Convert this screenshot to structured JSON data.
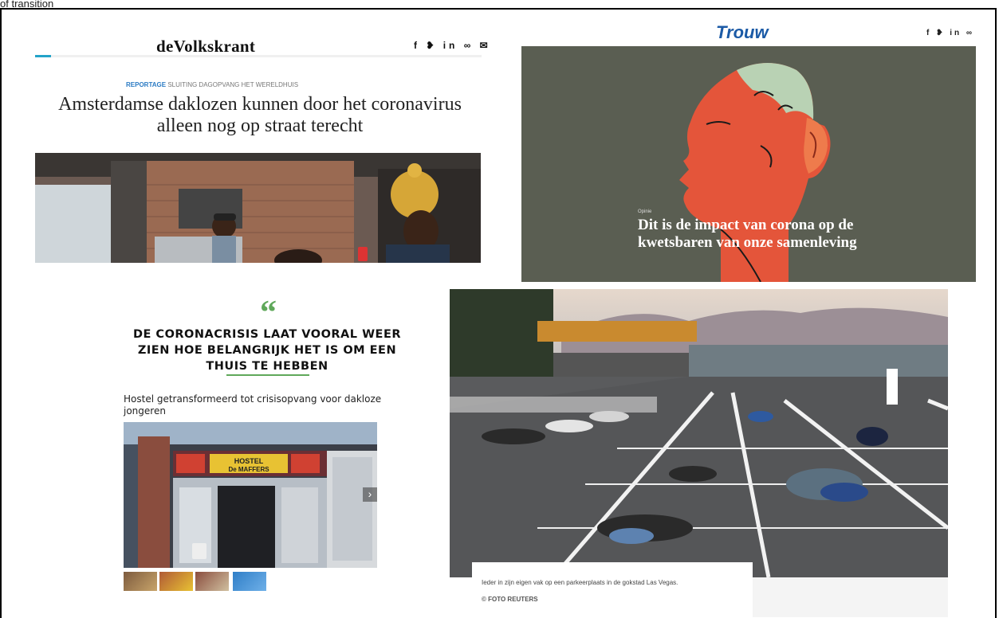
{
  "top_cut_text": "of transition",
  "volkskrant": {
    "logo": "deVolkskrant",
    "social": "f ❥ in ∞ ✉",
    "kicker_label": "REPORTAGE",
    "kicker_text": "SLUITING DAGOPVANG HET WERELDHUIS",
    "title": "Amsterdamse daklozen kunnen door het coronavirus alleen nog op straat terecht",
    "accent_color": "#23a3c9"
  },
  "trouw": {
    "logo": "Trouw",
    "social": "f ❥ in ∞",
    "kicker": "Opinie",
    "title": "Dit is de impact van corona op de kwetsbaren van onze samenleving",
    "bg_color": "#5a5e52",
    "face_color": "#e4553a"
  },
  "quote": {
    "mark": "“",
    "text": "DE CORONACRISIS LAAT VOORAL WEER ZIEN HOE BELANGRIJK HET IS OM EEN THUIS TE HEBBEN",
    "accent_color": "#5fa85a"
  },
  "hostel": {
    "title": "Hostel getransformeerd tot crisisopvang voor dakloze jongeren",
    "sign_text": "HOSTEL De MAFFERS",
    "next_arrow": "›"
  },
  "lasvegas": {
    "caption": "Ieder in zijn eigen vak op een parkeerplaats in de gokstad Las Vegas.",
    "credit": "© FOTO REUTERS"
  }
}
